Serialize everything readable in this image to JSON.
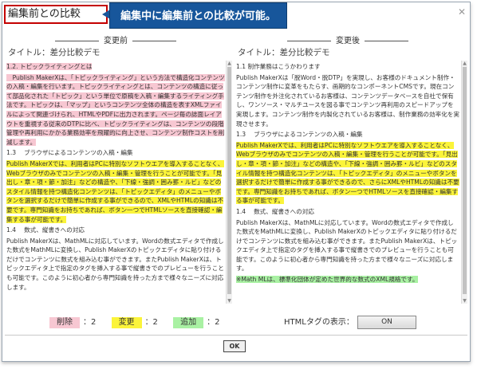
{
  "dialog": {
    "title": "編集前との比較",
    "callout": "編集中に編集前との比較が可能。",
    "close_glyph": "✕"
  },
  "left": {
    "header": "変更前",
    "doc_title": "タイトル：差分比較デモ",
    "lines": [
      {
        "text": "1.2. トピックライティングとは",
        "hl": "del"
      },
      {
        "text": "　Publish MakerXは、「トピックライティング」という方法で構造化コンテンツの入稿・編集を行います。トピックライティングとは、コンテンツの構造に従って部品化された「トピック」という単位で原稿を入稿・編集するライティング手法です。トピックは、「マップ」というコンテンツ全体の構造を表すXMLファイルによって関連づけられ、HTMLやPDFに出力されます。ページ毎の誌面レイアウトを重視する従来のDTPに比べ、トピックライティングは、コンテンツの段階管理や再利用にかかる業務効率を飛躍的に向上させ、コンテンツ制作コストを削減します。",
        "hl": "del"
      },
      {
        "text": "1.3　 ブラウザによるコンテンツの入稿・編集",
        "hl": ""
      },
      {
        "text": "Publish MakerXでは、利用者はPCに特別なソフトウエアを導入することなく、Webブラウザのみでコンテンツの入稿・編集・管理を行うことが可能です。「見出し・章・項・節・加注」などの構造や、「下線・強調・囲み罫・ルビ」などのスタイル情報を持つ構造化コンテンツは、「トピックエディタ」のメニューやボタンを選択するだけで簡単に作成する事ができるので、XMLやHTMLの知識は不要です。専門知識をお持ちであれば、ボタン一つでHTMLソースを直接確認・編集する事が可能です。",
        "hl": "chg"
      },
      {
        "text": "1.4　 数式、縦書きへの対応",
        "hl": ""
      },
      {
        "text": "Publish MakerXは、MathMLに対応しています。Wordの数式エディタで作成した数式をMathMLに変換し、Publish MakerXのトピックエディタに貼り付けるだけでコンテンツに数式を組み込む事ができます。またPublish MakerXは、トピックエディタ上で指定のタグを挿入する事で縦書きでのプレビューを行うことも可能です。このように初心者から専門知識を持った方まで様々なニーズに対応します。",
        "hl": ""
      }
    ]
  },
  "right": {
    "header": "変更後",
    "doc_title": "タイトル：差分比較デモ",
    "lines": [
      {
        "text": "1.1 制作業務はこうかわります",
        "hl": ""
      },
      {
        "text": "Publish MakerXは「脱Word・脱DTP」を実現し、お客様のドキュメント制作・コンテンツ制作に変革をもたらす、画期的なコンポーネントCMSです。現在コンテンツ制作を外注化されているお客様は、コンテンツデータベースを自社で保有し、ワンソース・マルチユースを図る事でコンテンツ再利用のスピードアップを実現します。コンテンツ制作を内製化されているお客様は、制作業務の効率化を実現させます。",
        "hl": ""
      },
      {
        "text": "1.3　 ブラウザによるコンテンツの入稿・編集",
        "hl": ""
      },
      {
        "text": "Publish MakerXでは、利用者はPCに特別なソフトウエアを導入することなく、Webブラウザのみでコンテンツの入稿・編集・管理を行うことが可能です。「見出し・章・項・節・加注」などの構造や、「下線・強調・囲み罫・ルビ」などのスタイル情報を持つ構造化コンテンツは、「トピックエディタ」のメニューやボタンを選択するだけで簡単に作成する事ができるので、さらにXMLやHTMLの知識は不要です。専門知識をお持ちであれば、ボタン一つでHTMLソースを直接確認・編集する事が可能です。",
        "hl": "chg"
      },
      {
        "text": "1.4　 数式、縦書きへの対応",
        "hl": ""
      },
      {
        "text": "Publish MakerXは、MathMLに対応しています。Wordの数式エディタで作成した数式をMathMLに変換し、Publish MakerXのトピックエディタに貼り付けるだけでコンテンツに数式を組み込む事ができます。またPublish MakerXは、トピックエディタ上で指定のタグを挿入する事で縦書きでのプレビューを行うことも可能です。このように初心者から専門知識を持った方まで様々なニーズに対応します。",
        "hl": ""
      },
      {
        "text": "※Math MLは、標準化団体が定めた世界的な数式のXML規格です。",
        "hl": "add"
      }
    ]
  },
  "legend": {
    "deleted_label": "削除",
    "deleted_count": "：2",
    "changed_label": "変更",
    "changed_count": "：2",
    "added_label": "追加",
    "added_count": "：2"
  },
  "html_tag": {
    "label": "HTMLタグの表示：",
    "toggle_value": "ON"
  },
  "ok_label": "OK",
  "colors": {
    "deleted": "#f7c7d2",
    "changed": "#fbf43a",
    "added": "#a9f1a3",
    "callout_bg": "#17569b",
    "title_border": "#c40000"
  }
}
